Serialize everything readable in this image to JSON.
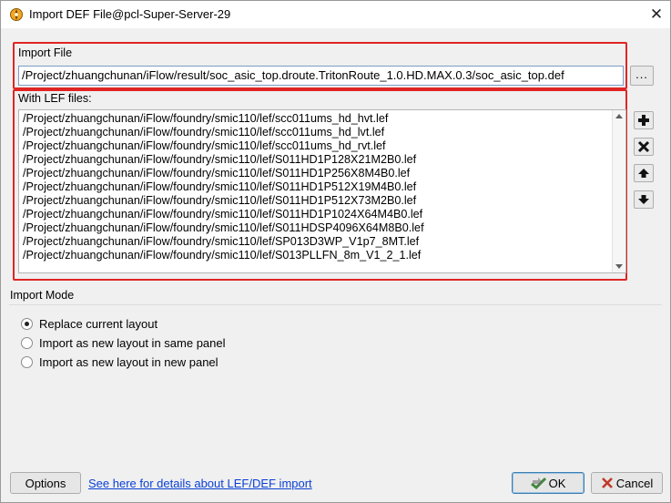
{
  "window": {
    "title": "Import DEF File@pcl-Super-Server-29",
    "close_glyph": "✕"
  },
  "import_file": {
    "label": "Import File",
    "path": "/Project/zhuangchunan/iFlow/result/soc_asic_top.droute.TritonRoute_1.0.HD.MAX.0.3/soc_asic_top.def",
    "browse_label": "..."
  },
  "lef": {
    "label": "With LEF files:",
    "files": [
      "/Project/zhuangchunan/iFlow/foundry/smic110/lef/scc011ums_hd_hvt.lef",
      "/Project/zhuangchunan/iFlow/foundry/smic110/lef/scc011ums_hd_lvt.lef",
      "/Project/zhuangchunan/iFlow/foundry/smic110/lef/scc011ums_hd_rvt.lef",
      "/Project/zhuangchunan/iFlow/foundry/smic110/lef/S011HD1P128X21M2B0.lef",
      "/Project/zhuangchunan/iFlow/foundry/smic110/lef/S011HD1P256X8M4B0.lef",
      "/Project/zhuangchunan/iFlow/foundry/smic110/lef/S011HD1P512X19M4B0.lef",
      "/Project/zhuangchunan/iFlow/foundry/smic110/lef/S011HD1P512X73M2B0.lef",
      "/Project/zhuangchunan/iFlow/foundry/smic110/lef/S011HD1P1024X64M4B0.lef",
      "/Project/zhuangchunan/iFlow/foundry/smic110/lef/S011HDSP4096X64M8B0.lef",
      "/Project/zhuangchunan/iFlow/foundry/smic110/lef/SP013D3WP_V1p7_8MT.lef",
      "/Project/zhuangchunan/iFlow/foundry/smic110/lef/S013PLLFN_8m_V1_2_1.lef"
    ],
    "side_buttons": [
      "plus-icon",
      "remove-icon",
      "arrow-up-icon",
      "arrow-down-icon"
    ]
  },
  "import_mode": {
    "label": "Import Mode",
    "options": [
      {
        "label": "Replace current layout",
        "checked": true
      },
      {
        "label": "Import as new layout in same panel",
        "checked": false
      },
      {
        "label": "Import as new layout in new panel",
        "checked": false
      }
    ]
  },
  "footer": {
    "options_label": "Options",
    "help_link": "See here for details about LEF/DEF import",
    "ok_label": "OK",
    "cancel_label": "Cancel"
  },
  "colors": {
    "highlight_border": "#e02424",
    "link": "#0a3fd6",
    "ok_icon": "#3f8a3a",
    "cancel_icon": "#c0392b"
  }
}
